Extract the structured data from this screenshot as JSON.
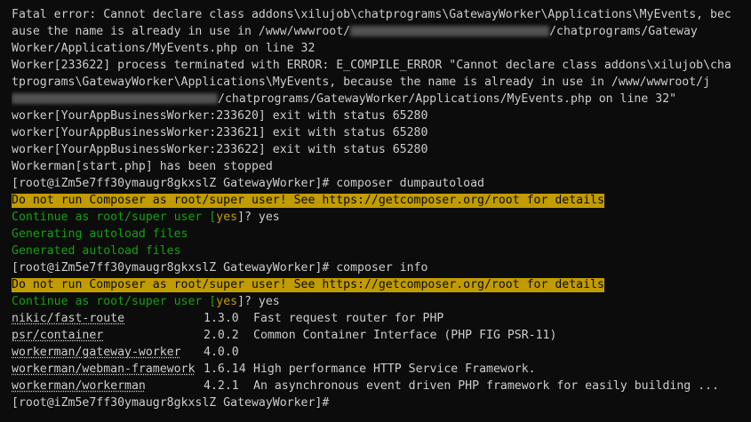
{
  "lines": {
    "l1": "Fatal error: Cannot declare class addons\\xilujob\\chatprograms\\GatewayWorker\\Applications\\MyEvents, bec",
    "l2a": "ause the name is already in use in /www/wwwroot/",
    "l2b": "/chatprograms/Gateway",
    "l3": "Worker/Applications/MyEvents.php on line 32",
    "l4": "Worker[233622] process terminated with ERROR: E_COMPILE_ERROR \"Cannot declare class addons\\xilujob\\cha",
    "l5": "tprograms\\GatewayWorker\\Applications\\MyEvents, because the name is already in use in /www/wwwroot/j",
    "l6b": "/chatprograms/GatewayWorker/Applications/MyEvents.php on line 32\"",
    "l7": "worker[YourAppBusinessWorker:233620] exit with status 65280",
    "l8": "worker[YourAppBusinessWorker:233621] exit with status 65280",
    "l9": "worker[YourAppBusinessWorker:233622] exit with status 65280",
    "l10": "Workerman[start.php] has been stopped",
    "prompt1": "[root@iZm5e7ff30ymaugr8gkxslZ GatewayWorker]# composer dumpautoload",
    "warn1": "Do not run Composer as root/super user! See https://getcomposer.org/root for details",
    "continue_pre": "Continue as root/super user [",
    "continue_yes": "yes",
    "continue_post": "]? yes",
    "gen1": "Generating autoload files",
    "gen2": "Generated autoload files",
    "prompt2": "[root@iZm5e7ff30ymaugr8gkxslZ GatewayWorker]# composer info",
    "warn2": "Do not run Composer as root/super user! See https://getcomposer.org/root for details",
    "prompt3": "[root@iZm5e7ff30ymaugr8gkxslZ GatewayWorker]#"
  },
  "packages": [
    {
      "name": "nikic/fast-route",
      "version": "1.3.0",
      "desc": "Fast request router for PHP"
    },
    {
      "name": "psr/container",
      "version": "2.0.2",
      "desc": "Common Container Interface (PHP FIG PSR-11)"
    },
    {
      "name": "workerman/gateway-worker",
      "version": "4.0.0",
      "desc": ""
    },
    {
      "name": "workerman/webman-framework",
      "version": "1.6.14",
      "desc": "High performance HTTP Service Framework."
    },
    {
      "name": "workerman/workerman",
      "version": "4.2.1",
      "desc": "An asynchronous event driven PHP framework for easily building ..."
    }
  ],
  "colors": {
    "background": "#0c0c0c",
    "text": "#cccccc",
    "green": "#13a10e",
    "warning_bg": "#c19c00"
  }
}
